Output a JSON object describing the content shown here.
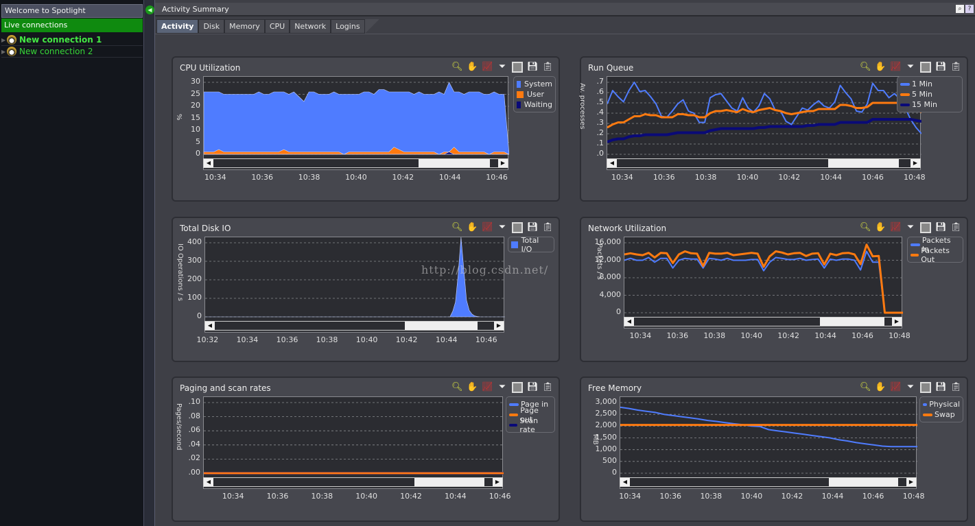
{
  "sidebar": {
    "welcome": "Welcome to Spotlight",
    "live_connections": "Live connections",
    "connections": [
      {
        "label": "New connection 1",
        "active": true
      },
      {
        "label": "New connection 2",
        "active": false
      }
    ]
  },
  "window": {
    "title": "Activity Summary",
    "zoom_button": "🔍",
    "help_button": "?"
  },
  "tabs": [
    {
      "label": "Activity",
      "active": true
    },
    {
      "label": "Disk"
    },
    {
      "label": "Memory"
    },
    {
      "label": "CPU"
    },
    {
      "label": "Network"
    },
    {
      "label": "Logins"
    }
  ],
  "watermark": "http://blog.csdn.net/",
  "toolbar_icons": [
    "zoom-icon",
    "pan-hand-icon",
    "chart-type-icon",
    "filter-icon",
    "window-icon",
    "save-icon",
    "clipboard-icon"
  ],
  "colors": {
    "blue": "#4f7cff",
    "orange": "#ff7a10",
    "navy": "#0a0a78",
    "accent_green": "#0f8a0f"
  },
  "chart_data": [
    {
      "id": "cpu",
      "title": "CPU Utilization",
      "type": "area",
      "ylabel": "%",
      "yticks": [
        "30",
        "25",
        "20",
        "15",
        "10",
        "5",
        "0"
      ],
      "ylim": [
        0,
        30
      ],
      "xticks": [
        "10:34",
        "10:36",
        "10:38",
        "10:40",
        "10:42",
        "10:44",
        "10:46"
      ],
      "xrange_min": [
        32.6,
        47.3
      ],
      "legend": [
        "System",
        "User",
        "Waiting"
      ],
      "series": [
        {
          "name": "System",
          "color": "#4f7cff",
          "values": [
            26,
            26,
            26,
            26,
            25,
            25,
            25,
            25,
            25,
            25,
            25,
            26,
            25,
            25,
            26,
            26,
            26,
            25,
            26,
            24,
            22,
            26,
            26,
            25,
            25,
            25,
            26,
            25,
            25,
            25,
            25,
            25,
            26,
            26,
            25,
            27,
            27,
            26,
            26,
            26,
            26,
            26,
            25,
            26,
            25,
            25,
            25,
            26,
            25,
            30,
            26,
            26,
            25,
            26,
            26,
            26,
            25,
            25,
            26,
            25,
            25,
            0
          ]
        },
        {
          "name": "User",
          "color": "#ff7a10",
          "values": [
            1,
            1,
            1,
            2,
            1,
            1,
            1,
            1,
            1,
            1,
            1,
            1,
            1,
            1,
            1,
            1,
            2,
            1,
            1,
            1,
            1,
            1,
            1,
            1,
            1,
            1,
            1,
            1,
            0,
            1,
            1,
            1,
            1,
            1,
            1,
            1,
            1,
            1,
            3,
            2,
            1,
            1,
            1,
            1,
            1,
            1,
            1,
            0,
            1,
            1,
            3,
            1,
            1,
            1,
            1,
            1,
            1,
            0,
            1,
            1,
            1,
            0
          ]
        },
        {
          "name": "Waiting",
          "color": "#0a0a78",
          "values": [
            0,
            0,
            0,
            0,
            0,
            0,
            0,
            0,
            0,
            0,
            0,
            0,
            0,
            0,
            0,
            0,
            0,
            0,
            0,
            0,
            0,
            0,
            0,
            0,
            0,
            0,
            0,
            0,
            0,
            0,
            0,
            0,
            0,
            0,
            0,
            0,
            0,
            0,
            0,
            0,
            0,
            0,
            0,
            0,
            0,
            0,
            0,
            0,
            0,
            1,
            0,
            0,
            0,
            0,
            0,
            0,
            0,
            0,
            0,
            0,
            0,
            0
          ]
        }
      ],
      "scroll_thumb": [
        0.72,
        0.97
      ]
    },
    {
      "id": "runqueue",
      "title": "Run Queue",
      "type": "line",
      "ylabel": "Av. processes",
      "yticks": [
        ".7",
        ".6",
        ".5",
        ".4",
        ".3",
        ".2",
        ".1",
        ".0"
      ],
      "ylim": [
        0,
        0.7
      ],
      "xticks": [
        "10:34",
        "10:36",
        "10:38",
        "10:40",
        "10:42",
        "10:44",
        "10:46",
        "10:48"
      ],
      "legend": [
        "1 Min",
        "5 Min",
        "15 Min"
      ],
      "series": [
        {
          "name": "1 Min",
          "color": "#4f7cff",
          "values": [
            0.49,
            0.62,
            0.56,
            0.51,
            0.62,
            0.7,
            0.61,
            0.62,
            0.56,
            0.49,
            0.37,
            0.36,
            0.42,
            0.49,
            0.53,
            0.42,
            0.4,
            0.31,
            0.31,
            0.55,
            0.58,
            0.59,
            0.52,
            0.45,
            0.42,
            0.55,
            0.45,
            0.41,
            0.47,
            0.59,
            0.54,
            0.43,
            0.42,
            0.32,
            0.29,
            0.37,
            0.45,
            0.43,
            0.48,
            0.52,
            0.47,
            0.45,
            0.51,
            0.67,
            0.6,
            0.54,
            0.42,
            0.41,
            0.49,
            0.69,
            0.62,
            0.62,
            0.55,
            0.59,
            0.54,
            0.45,
            0.34,
            0.26,
            0.2
          ]
        },
        {
          "name": "5 Min",
          "color": "#ff7a10",
          "values": [
            0.26,
            0.29,
            0.31,
            0.31,
            0.34,
            0.37,
            0.37,
            0.39,
            0.38,
            0.38,
            0.36,
            0.36,
            0.36,
            0.39,
            0.39,
            0.38,
            0.38,
            0.36,
            0.36,
            0.4,
            0.42,
            0.42,
            0.43,
            0.42,
            0.41,
            0.44,
            0.42,
            0.41,
            0.43,
            0.44,
            0.45,
            0.43,
            0.42,
            0.4,
            0.39,
            0.4,
            0.41,
            0.42,
            0.42,
            0.44,
            0.44,
            0.44,
            0.44,
            0.48,
            0.48,
            0.47,
            0.45,
            0.45,
            0.46,
            0.5,
            0.5,
            0.5,
            0.5,
            0.5,
            0.5,
            0.47,
            0.45,
            0.43,
            0.41
          ]
        },
        {
          "name": "15 Min",
          "color": "#0a0a78",
          "values": [
            0.12,
            0.14,
            0.15,
            0.15,
            0.17,
            0.18,
            0.18,
            0.19,
            0.19,
            0.19,
            0.19,
            0.19,
            0.2,
            0.21,
            0.21,
            0.21,
            0.21,
            0.21,
            0.21,
            0.23,
            0.24,
            0.25,
            0.25,
            0.25,
            0.25,
            0.25,
            0.25,
            0.25,
            0.26,
            0.26,
            0.27,
            0.27,
            0.27,
            0.27,
            0.27,
            0.27,
            0.27,
            0.28,
            0.28,
            0.29,
            0.29,
            0.29,
            0.29,
            0.31,
            0.31,
            0.31,
            0.31,
            0.31,
            0.31,
            0.34,
            0.34,
            0.34,
            0.34,
            0.34,
            0.34,
            0.34,
            0.34,
            0.33,
            0.32
          ]
        }
      ],
      "scroll_thumb": [
        0.72,
        0.96
      ]
    },
    {
      "id": "diskio",
      "title": "Total Disk IO",
      "type": "area",
      "ylabel": "IO Operations / s",
      "yticks": [
        "400",
        "300",
        "200",
        "100",
        "0"
      ],
      "ylim": [
        0,
        400
      ],
      "xticks": [
        "10:32",
        "10:34",
        "10:36",
        "10:38",
        "10:40",
        "10:42",
        "10:44",
        "10:46"
      ],
      "legend": [
        "Total I/O"
      ],
      "series": [
        {
          "name": "Total I/O",
          "color": "#4f7cff",
          "values": [
            0,
            0,
            0,
            0,
            0,
            0,
            0,
            0,
            0,
            0,
            0,
            0,
            0,
            0,
            0,
            0,
            0,
            0,
            0,
            0,
            0,
            0,
            0,
            0,
            0,
            0,
            0,
            0,
            0,
            0,
            0,
            0,
            0,
            0,
            0,
            0,
            0,
            0,
            0,
            0,
            0,
            0,
            0,
            0,
            0,
            0,
            0,
            0,
            0,
            0,
            0,
            0,
            0,
            0,
            0,
            0,
            0,
            0,
            0,
            0,
            0,
            0,
            0,
            0,
            0,
            0,
            0,
            0,
            0,
            0,
            0,
            0,
            0,
            0,
            0,
            0,
            0,
            0,
            0,
            0,
            0,
            0,
            0,
            0,
            0,
            0,
            0,
            0,
            0,
            0,
            30,
            80,
            230,
            430,
            260,
            90,
            35,
            15,
            5,
            2,
            0,
            0,
            0,
            0,
            0,
            0,
            0,
            0,
            0,
            0
          ]
        }
      ],
      "scroll_thumb": [
        0.68,
        0.94
      ]
    },
    {
      "id": "network",
      "title": "Network Utilization",
      "type": "line",
      "ylabel": "Packets / s",
      "yticks": [
        "16,000",
        "12,000",
        "8,000",
        "4,000",
        "0"
      ],
      "ylim": [
        0,
        18000
      ],
      "xticks": [
        "10:34",
        "10:36",
        "10:38",
        "10:40",
        "10:42",
        "10:44",
        "10:46",
        "10:48"
      ],
      "legend": [
        "Packets In",
        "Packets Out"
      ],
      "series": [
        {
          "name": "Packets In",
          "color": "#4f7cff",
          "values": [
            13500,
            14000,
            13500,
            13500,
            14200,
            13000,
            14000,
            14000,
            11500,
            13500,
            14000,
            13800,
            13800,
            11500,
            14000,
            13800,
            13500,
            14000,
            13500,
            13500,
            13500,
            13700,
            13700,
            10800,
            13000,
            14200,
            14000,
            13700,
            13700,
            14000,
            13500,
            13700,
            13800,
            11500,
            13800,
            13500,
            13800,
            13800,
            13500,
            11000,
            15800,
            13000,
            13000,
            0,
            0,
            0,
            0
          ]
        },
        {
          "name": "Packets Out",
          "color": "#ff7a10",
          "values": [
            15000,
            15300,
            15000,
            14800,
            15400,
            14200,
            15400,
            15300,
            12800,
            15000,
            15800,
            15300,
            15200,
            12000,
            15400,
            15200,
            15200,
            15400,
            14800,
            15000,
            15200,
            15400,
            15200,
            11800,
            14500,
            15800,
            15500,
            15000,
            15300,
            15400,
            14600,
            15200,
            15300,
            12400,
            15200,
            14800,
            15300,
            15400,
            15000,
            12500,
            17500,
            14500,
            14600,
            0,
            0,
            0,
            0
          ]
        }
      ],
      "scroll_thumb": [
        0.72,
        0.97
      ]
    },
    {
      "id": "paging",
      "title": "Paging and scan rates",
      "type": "line",
      "ylabel": "Pages/second",
      "yticks": [
        ".10",
        ".08",
        ".06",
        ".04",
        ".02",
        ".00"
      ],
      "ylim": [
        0,
        0.1
      ],
      "xticks": [
        "10:34",
        "10:36",
        "10:38",
        "10:40",
        "10:42",
        "10:44",
        "10:46"
      ],
      "legend": [
        "Page in",
        "Page out",
        "Scan rate"
      ],
      "series": [
        {
          "name": "Page in",
          "color": "#4f7cff",
          "values": [
            0,
            0
          ]
        },
        {
          "name": "Scan rate",
          "color": "#0a0a78",
          "values": [
            0,
            0
          ]
        },
        {
          "name": "Page out",
          "color": "#ff7a10",
          "values": [
            0,
            0
          ]
        }
      ],
      "scroll_thumb": [
        0.72,
        0.97
      ]
    },
    {
      "id": "memory",
      "title": "Free Memory",
      "type": "line",
      "ylabel": "MB",
      "yticks": [
        "3,000",
        "2,500",
        "2,000",
        "1,500",
        "1,000",
        "500",
        "0"
      ],
      "ylim": [
        0,
        3000
      ],
      "xticks": [
        "10:34",
        "10:36",
        "10:38",
        "10:40",
        "10:42",
        "10:44",
        "10:46",
        "10:48"
      ],
      "legend": [
        "Physical",
        "Swap"
      ],
      "series": [
        {
          "name": "Physical",
          "color": "#4f7cff",
          "values": [
            2800,
            2750,
            2680,
            2630,
            2580,
            2500,
            2450,
            2400,
            2350,
            2300,
            2240,
            2200,
            2150,
            2100,
            2060,
            2000,
            1980,
            1850,
            1800,
            1750,
            1700,
            1650,
            1600,
            1550,
            1500,
            1420,
            1370,
            1300,
            1250,
            1200,
            1150,
            1130,
            1130,
            1130,
            1130
          ]
        },
        {
          "name": "Swap",
          "color": "#ff7a10",
          "values": [
            2050,
            2050
          ]
        }
      ],
      "scroll_thumb": [
        0.72,
        0.97
      ]
    }
  ]
}
